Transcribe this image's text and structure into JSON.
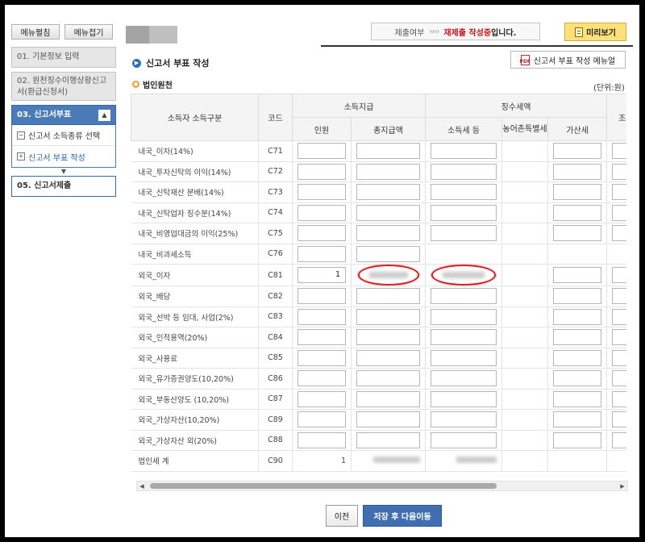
{
  "sidebar": {
    "expand_all": "메뉴펼침",
    "collapse_all": "메뉴접기",
    "steps": {
      "s1": "01. 기본정보 입력",
      "s2": "02. 원천징수이행상황신고서(환급신청서)",
      "s3": "03. 신고서부표",
      "s5": "05. 신고서제출"
    },
    "substeps": [
      "신고서 소득종류 선택",
      "신고서 부표 작성"
    ]
  },
  "topbar": {
    "status_label": "제출여부",
    "status_arrows": "››››",
    "status_value": "재제출 작성중",
    "status_suffix": "입니다.",
    "preview": "미리보기"
  },
  "page": {
    "title": "신고서 부표 작성",
    "manual": "신고서 부표 작성 메뉴얼",
    "section": "법인원천",
    "unit": "(단위:원)"
  },
  "table": {
    "headers": {
      "kind": "소득자 소득구분",
      "code": "코드",
      "group_pay": "소득지급",
      "group_tax": "징수세액",
      "people": "인원",
      "total_pay": "총지급액",
      "income_tax": "소득세 등",
      "rural_tax": "농어촌특별세",
      "add_tax": "가산세",
      "next": "조"
    },
    "rows": [
      {
        "kind": "내국_이자(14%)",
        "code": "C71",
        "people": ""
      },
      {
        "kind": "내국_투자신탁의 이익(14%)",
        "code": "C72",
        "people": ""
      },
      {
        "kind": "내국_신탁재산 분배(14%)",
        "code": "C73",
        "people": ""
      },
      {
        "kind": "내국_신탁업자 징수분(14%)",
        "code": "C74",
        "people": ""
      },
      {
        "kind": "내국_비영업대금의 이익(25%)",
        "code": "C75",
        "people": ""
      },
      {
        "kind": "내국_비과세소득",
        "code": "C76",
        "people": ""
      },
      {
        "kind": "외국_이자",
        "code": "C81",
        "people": "1"
      },
      {
        "kind": "외국_배당",
        "code": "C82",
        "people": ""
      },
      {
        "kind": "외국_선박 등 임대, 사업(2%)",
        "code": "C83",
        "people": ""
      },
      {
        "kind": "외국_인적용역(20%)",
        "code": "C84",
        "people": ""
      },
      {
        "kind": "외국_사용료",
        "code": "C85",
        "people": ""
      },
      {
        "kind": "외국_유가증권양도(10,20%)",
        "code": "C86",
        "people": ""
      },
      {
        "kind": "외국_부동산양도 (10,20%)",
        "code": "C87",
        "people": ""
      },
      {
        "kind": "외국_가상자산(10,20%)",
        "code": "C89",
        "people": ""
      },
      {
        "kind": "외국_가상자산 외(20%)",
        "code": "C88",
        "people": ""
      }
    ],
    "total": {
      "kind": "법인세 계",
      "code": "C90",
      "people": "1"
    }
  },
  "buttons": {
    "prev": "이전",
    "save_next": "저장 후 다음이동"
  }
}
